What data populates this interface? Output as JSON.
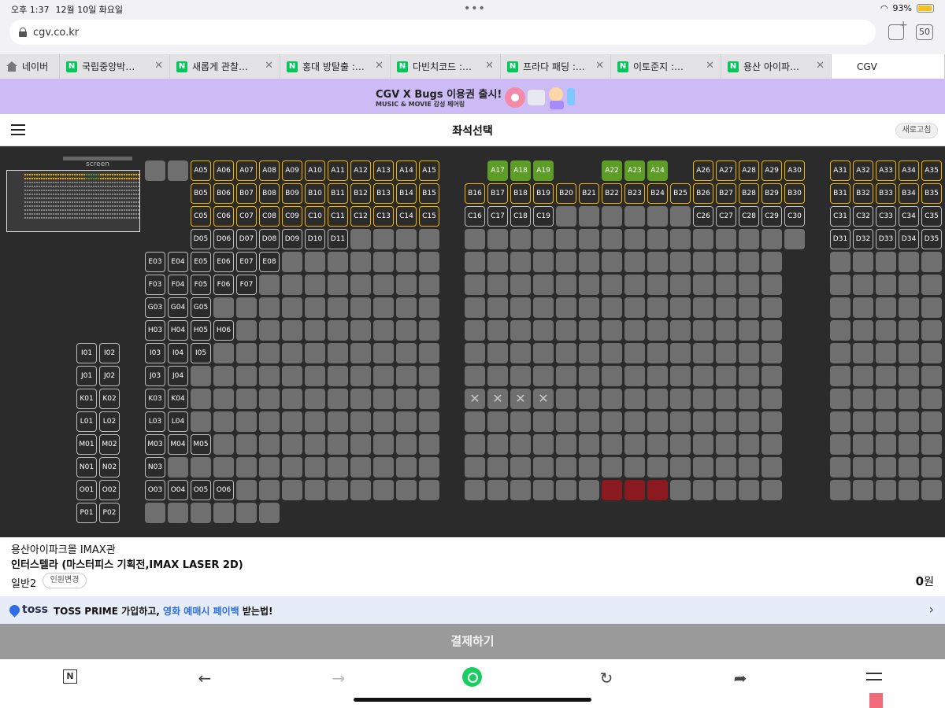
{
  "status": {
    "ampm": "오후 1:37",
    "date": "12월 10일 화요일",
    "battery": "93%",
    "battery_level": 0.93
  },
  "browser": {
    "url": "cgv.co.kr",
    "tab_count": "50",
    "tabs": [
      {
        "label": "네이버",
        "icon": "home-icon"
      },
      {
        "label": "국립중앙박…",
        "icon": "naver-icon"
      },
      {
        "label": "새롭게 관찰…",
        "icon": "naver-icon"
      },
      {
        "label": "홍대 방탈출 :…",
        "icon": "naver-icon"
      },
      {
        "label": "다빈치코드 :…",
        "icon": "naver-icon"
      },
      {
        "label": "프라다 패딩 :…",
        "icon": "naver-icon"
      },
      {
        "label": "이토준지 :…",
        "icon": "naver-icon"
      },
      {
        "label": "용산 아이파…",
        "icon": "naver-icon"
      },
      {
        "label": "CGV",
        "icon": "cgv-icon"
      }
    ],
    "naver_letter": "N",
    "cgv_letter": "CGV"
  },
  "banner": {
    "title": "CGV X Bugs 이용권 출시!",
    "subtitle": "MUSIC & MOVIE 감성 페어링"
  },
  "header": {
    "title": "좌석선택",
    "refresh": "새로고침"
  },
  "seatmap": {
    "screen_label": "screen",
    "colors": {
      "available_border": "#f0b400",
      "selected": "#5e9c28",
      "sold": "#6f6f6f",
      "background": "#2b2b2b"
    }
  },
  "info": {
    "theater": "용산아이파크몰 IMAX관",
    "movie": "인터스텔라 (마스터피스 기획전,IMAX LASER 2D)",
    "people": "일반2",
    "people_change": "인원변경",
    "price_amount": "0",
    "price_unit": "원"
  },
  "toss": {
    "logo": "toss",
    "text_a": "TOSS PRIME 가입하고, ",
    "text_b": "영화 예매시 페이백",
    "text_c": " 받는법!"
  },
  "pay": {
    "label": "결제하기"
  },
  "toolbar": {
    "n_letter": "N"
  }
}
